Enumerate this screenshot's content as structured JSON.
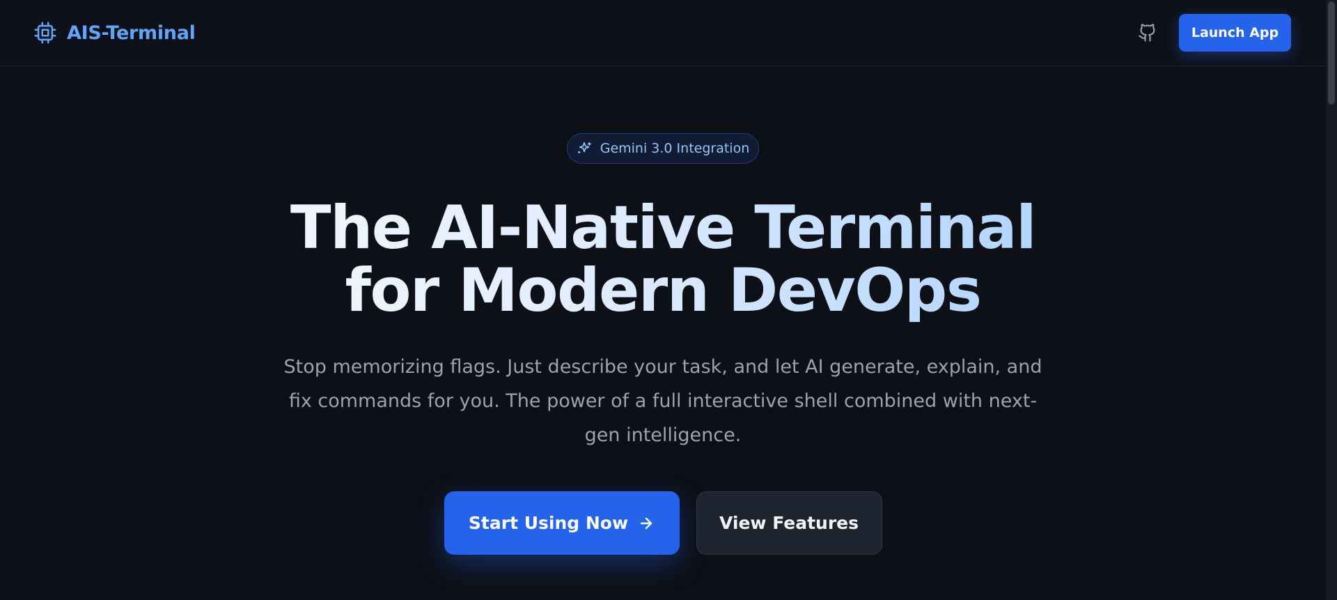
{
  "header": {
    "brand_name": "AIS-Terminal",
    "brand_icon": "cpu-chip-icon",
    "github_icon": "github-icon",
    "launch_label": "Launch App",
    "accent_color": "#2563eb",
    "brand_color": "#60a5fa"
  },
  "hero": {
    "badge": {
      "icon": "sparkles-icon",
      "label": "Gemini 3.0 Integration"
    },
    "headline": {
      "line1_plain": "The AI-Native ",
      "line1_accent": "Terminal",
      "line2_plain": "for Modern ",
      "line2_accent": "DevOps"
    },
    "subtitle": "Stop memorizing flags. Just describe your task, and let AI generate, explain, and fix commands for you. The power of a full interactive shell combined with next-gen intelligence.",
    "primary_cta": {
      "label": "Start Using Now",
      "icon": "arrow-right-icon"
    },
    "secondary_cta": {
      "label": "View Features"
    }
  },
  "colors": {
    "background": "#0d1017",
    "muted_text": "#9ca3af",
    "secondary_button": "#1e2430"
  }
}
